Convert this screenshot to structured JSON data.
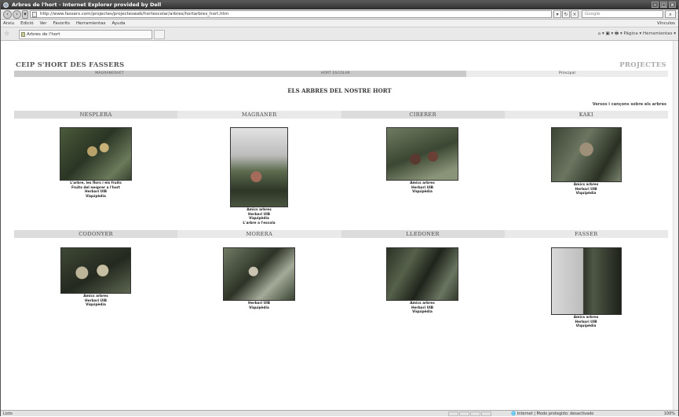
{
  "browser": {
    "window_title": "Arbres de l'hort - Internet Explorer provided by Dell",
    "address": "http://www.fassers.com/projectes/projectesweb/hortescolar/arbres/hortarbres_hort.htm",
    "search_placeholder": "Google",
    "menu": [
      "Arxiu",
      "Edició",
      "Ver",
      "Favorits",
      "Herramientas",
      "Ayuda"
    ],
    "vinculos": "Vínculos",
    "tab_title": "Arbres de l'hort",
    "command_bar": "Página ▾  Herramientas ▾",
    "status_left": "Listo",
    "status_zone": "Internet | Modo protegido: desactivado",
    "status_zoom": "100%"
  },
  "site": {
    "title": "CEIP S'HORT DES FASSERS",
    "projects": "PROJECTES",
    "nav": [
      "MAGRANERAET",
      "HORT ESCOLAR",
      "Principal"
    ],
    "heading": "ELS ARBRES DEL NOSTRE HORT",
    "subnote": "Versos i cançons sobre els arbres"
  },
  "trees": [
    {
      "name": "NESPLERA",
      "links": [
        "L'arbre, les flors i els fruits",
        "Fruits del nesprer a l'hort",
        "Herbari UIB",
        "Viquipèdia"
      ]
    },
    {
      "name": "MAGRANER",
      "links": [
        "Amics arbres",
        "Herbari UIB",
        "Viquipèdia",
        "L'arbre a l'escola"
      ]
    },
    {
      "name": "CIRERER",
      "links": [
        "Amics arbres",
        "Herbari UIB",
        "Viquipèdia"
      ]
    },
    {
      "name": "KAKI",
      "links": [
        "Amics arbres",
        "Herbari UIB",
        "Viquipèdia"
      ]
    },
    {
      "name": "CODONYER",
      "links": [
        "Amics arbres",
        "Herbari UIB",
        "Viquipèdia"
      ]
    },
    {
      "name": "MORERA",
      "links": [
        "Herbari UIB",
        "Viquipèdia"
      ]
    },
    {
      "name": "LLEDONER",
      "links": [
        "Amics arbres",
        "Herbari UIB",
        "Viquipèdia"
      ]
    },
    {
      "name": "FASSER",
      "links": [
        "Amics arbres",
        "Herbari UIB",
        "Viquipèdia"
      ]
    }
  ],
  "colors": {
    "header_dark": "#c9c9c9",
    "header_light": "#ececec",
    "title_text": "#555555",
    "projects_text": "#aaaaaa"
  }
}
